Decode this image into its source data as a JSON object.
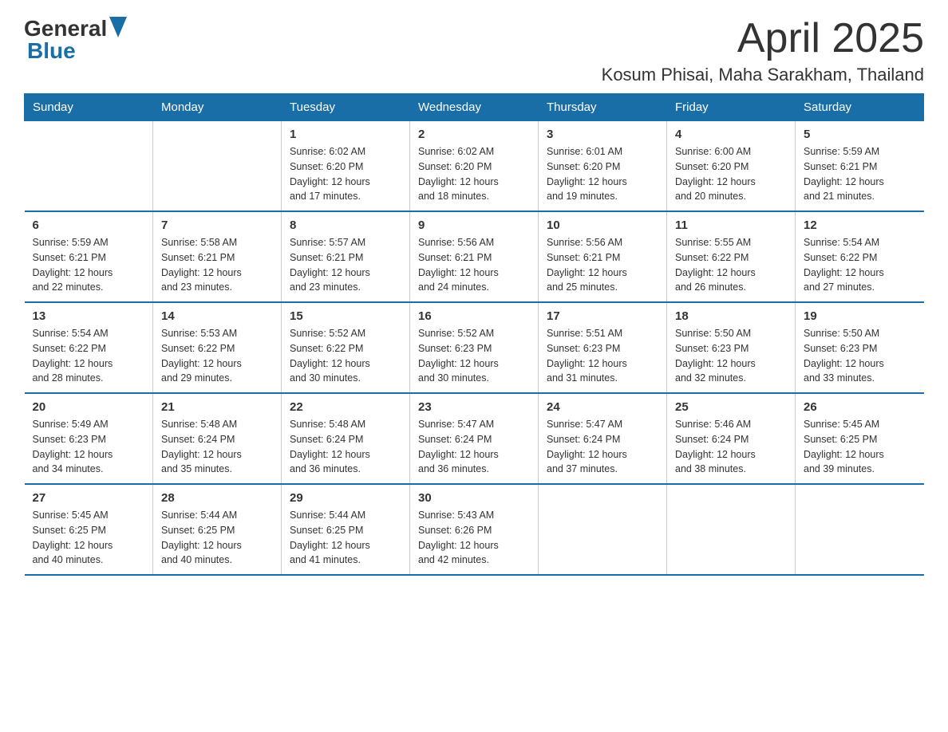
{
  "header": {
    "logo_general": "General",
    "logo_blue": "Blue",
    "month_title": "April 2025",
    "location": "Kosum Phisai, Maha Sarakham, Thailand"
  },
  "days_of_week": [
    "Sunday",
    "Monday",
    "Tuesday",
    "Wednesday",
    "Thursday",
    "Friday",
    "Saturday"
  ],
  "weeks": [
    [
      {
        "day": "",
        "info": ""
      },
      {
        "day": "",
        "info": ""
      },
      {
        "day": "1",
        "info": "Sunrise: 6:02 AM\nSunset: 6:20 PM\nDaylight: 12 hours\nand 17 minutes."
      },
      {
        "day": "2",
        "info": "Sunrise: 6:02 AM\nSunset: 6:20 PM\nDaylight: 12 hours\nand 18 minutes."
      },
      {
        "day": "3",
        "info": "Sunrise: 6:01 AM\nSunset: 6:20 PM\nDaylight: 12 hours\nand 19 minutes."
      },
      {
        "day": "4",
        "info": "Sunrise: 6:00 AM\nSunset: 6:20 PM\nDaylight: 12 hours\nand 20 minutes."
      },
      {
        "day": "5",
        "info": "Sunrise: 5:59 AM\nSunset: 6:21 PM\nDaylight: 12 hours\nand 21 minutes."
      }
    ],
    [
      {
        "day": "6",
        "info": "Sunrise: 5:59 AM\nSunset: 6:21 PM\nDaylight: 12 hours\nand 22 minutes."
      },
      {
        "day": "7",
        "info": "Sunrise: 5:58 AM\nSunset: 6:21 PM\nDaylight: 12 hours\nand 23 minutes."
      },
      {
        "day": "8",
        "info": "Sunrise: 5:57 AM\nSunset: 6:21 PM\nDaylight: 12 hours\nand 23 minutes."
      },
      {
        "day": "9",
        "info": "Sunrise: 5:56 AM\nSunset: 6:21 PM\nDaylight: 12 hours\nand 24 minutes."
      },
      {
        "day": "10",
        "info": "Sunrise: 5:56 AM\nSunset: 6:21 PM\nDaylight: 12 hours\nand 25 minutes."
      },
      {
        "day": "11",
        "info": "Sunrise: 5:55 AM\nSunset: 6:22 PM\nDaylight: 12 hours\nand 26 minutes."
      },
      {
        "day": "12",
        "info": "Sunrise: 5:54 AM\nSunset: 6:22 PM\nDaylight: 12 hours\nand 27 minutes."
      }
    ],
    [
      {
        "day": "13",
        "info": "Sunrise: 5:54 AM\nSunset: 6:22 PM\nDaylight: 12 hours\nand 28 minutes."
      },
      {
        "day": "14",
        "info": "Sunrise: 5:53 AM\nSunset: 6:22 PM\nDaylight: 12 hours\nand 29 minutes."
      },
      {
        "day": "15",
        "info": "Sunrise: 5:52 AM\nSunset: 6:22 PM\nDaylight: 12 hours\nand 30 minutes."
      },
      {
        "day": "16",
        "info": "Sunrise: 5:52 AM\nSunset: 6:23 PM\nDaylight: 12 hours\nand 30 minutes."
      },
      {
        "day": "17",
        "info": "Sunrise: 5:51 AM\nSunset: 6:23 PM\nDaylight: 12 hours\nand 31 minutes."
      },
      {
        "day": "18",
        "info": "Sunrise: 5:50 AM\nSunset: 6:23 PM\nDaylight: 12 hours\nand 32 minutes."
      },
      {
        "day": "19",
        "info": "Sunrise: 5:50 AM\nSunset: 6:23 PM\nDaylight: 12 hours\nand 33 minutes."
      }
    ],
    [
      {
        "day": "20",
        "info": "Sunrise: 5:49 AM\nSunset: 6:23 PM\nDaylight: 12 hours\nand 34 minutes."
      },
      {
        "day": "21",
        "info": "Sunrise: 5:48 AM\nSunset: 6:24 PM\nDaylight: 12 hours\nand 35 minutes."
      },
      {
        "day": "22",
        "info": "Sunrise: 5:48 AM\nSunset: 6:24 PM\nDaylight: 12 hours\nand 36 minutes."
      },
      {
        "day": "23",
        "info": "Sunrise: 5:47 AM\nSunset: 6:24 PM\nDaylight: 12 hours\nand 36 minutes."
      },
      {
        "day": "24",
        "info": "Sunrise: 5:47 AM\nSunset: 6:24 PM\nDaylight: 12 hours\nand 37 minutes."
      },
      {
        "day": "25",
        "info": "Sunrise: 5:46 AM\nSunset: 6:24 PM\nDaylight: 12 hours\nand 38 minutes."
      },
      {
        "day": "26",
        "info": "Sunrise: 5:45 AM\nSunset: 6:25 PM\nDaylight: 12 hours\nand 39 minutes."
      }
    ],
    [
      {
        "day": "27",
        "info": "Sunrise: 5:45 AM\nSunset: 6:25 PM\nDaylight: 12 hours\nand 40 minutes."
      },
      {
        "day": "28",
        "info": "Sunrise: 5:44 AM\nSunset: 6:25 PM\nDaylight: 12 hours\nand 40 minutes."
      },
      {
        "day": "29",
        "info": "Sunrise: 5:44 AM\nSunset: 6:25 PM\nDaylight: 12 hours\nand 41 minutes."
      },
      {
        "day": "30",
        "info": "Sunrise: 5:43 AM\nSunset: 6:26 PM\nDaylight: 12 hours\nand 42 minutes."
      },
      {
        "day": "",
        "info": ""
      },
      {
        "day": "",
        "info": ""
      },
      {
        "day": "",
        "info": ""
      }
    ]
  ]
}
